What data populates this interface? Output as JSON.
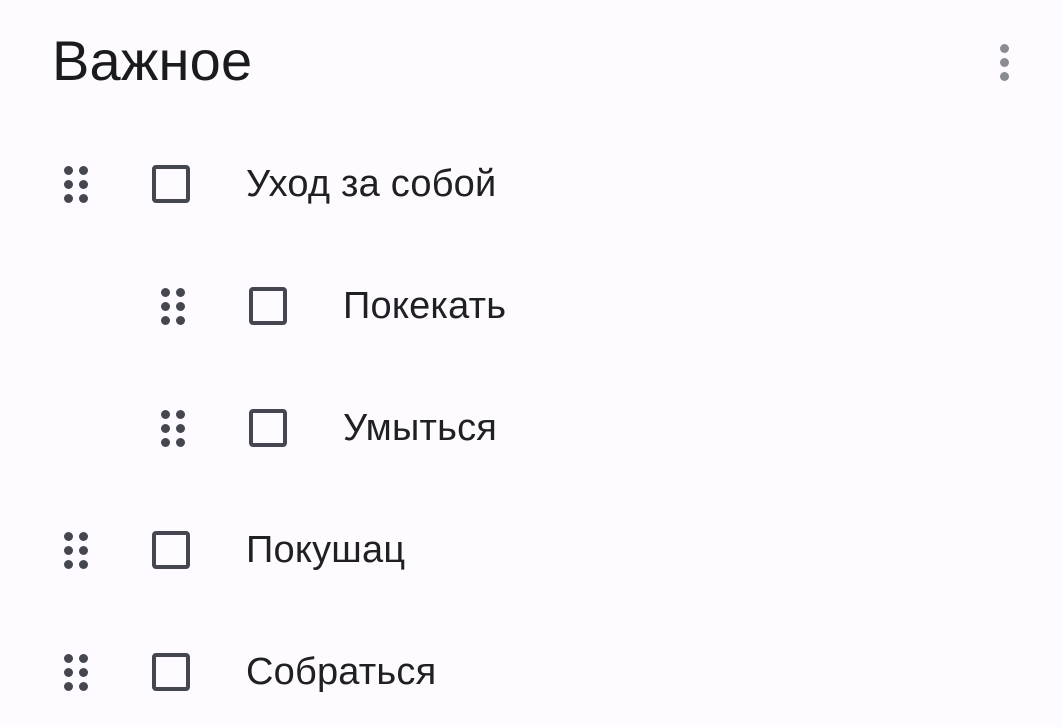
{
  "header": {
    "title": "Важное",
    "menu_icon": "more-vert-icon"
  },
  "icons": {
    "drag_handle": "drag-indicator-icon",
    "checkbox": "checkbox-unchecked-icon"
  },
  "items": [
    {
      "label": "Уход за собой",
      "checked": false,
      "indent": 0
    },
    {
      "label": "Покекать",
      "checked": false,
      "indent": 1
    },
    {
      "label": "Умыться",
      "checked": false,
      "indent": 1
    },
    {
      "label": "Покушац",
      "checked": false,
      "indent": 0
    },
    {
      "label": "Собраться",
      "checked": false,
      "indent": 0
    }
  ],
  "colors": {
    "background": "#fdfbff",
    "text": "#1f1f24",
    "icon": "#45464f",
    "menu_icon": "#8b8b92"
  }
}
